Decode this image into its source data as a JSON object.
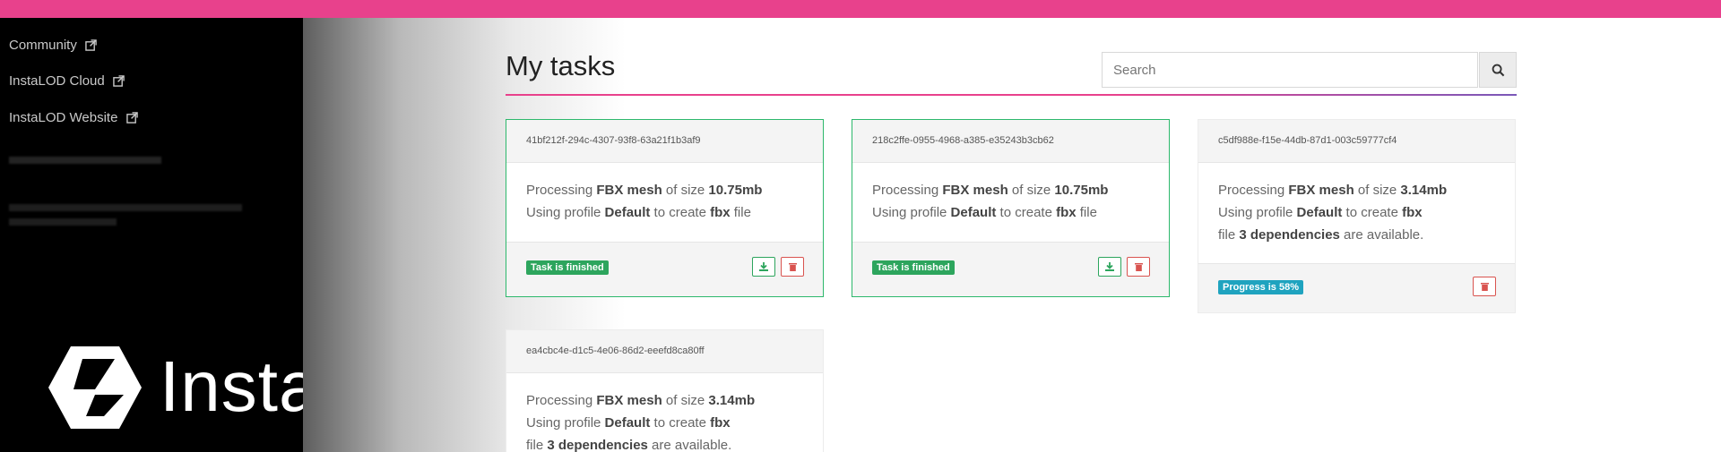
{
  "sidebar": {
    "links": [
      {
        "label": "Community"
      },
      {
        "label": "InstaLOD Cloud"
      },
      {
        "label": "InstaLOD Website"
      }
    ],
    "brand": "InstaLOD"
  },
  "main": {
    "title": "My tasks",
    "search": {
      "placeholder": "Search"
    }
  },
  "tasks": [
    {
      "id": "41bf212f-294c-4307-93f8-63a21f1b3af9",
      "line1_prefix": "Processing ",
      "format": "FBX mesh",
      "line1_mid": " of size ",
      "size": "10.75mb",
      "line2_prefix": "Using profile ",
      "profile": "Default",
      "line2_mid": " to create ",
      "ext": "fbx",
      "line2_suffix": " file",
      "status": "Task is finished"
    },
    {
      "id": "218c2ffe-0955-4968-a385-e35243b3cb62",
      "line1_prefix": "Processing ",
      "format": "FBX mesh",
      "line1_mid": " of size ",
      "size": "10.75mb",
      "line2_prefix": "Using profile ",
      "profile": "Default",
      "line2_mid": " to create ",
      "ext": "fbx",
      "line2_suffix": " file",
      "status": "Task is finished"
    },
    {
      "id": "c5df988e-f15e-44db-87d1-003c59777cf4",
      "line1_prefix": "Processing ",
      "format": "FBX mesh",
      "line1_mid": " of size ",
      "size": "3.14mb",
      "line2_prefix": "Using profile ",
      "profile": "Default",
      "line2_mid": " to create ",
      "ext": "fbx",
      "line3_prefix": "file ",
      "deps": "3 dependencies",
      "line3_suffix": " are available.",
      "status": "Progress is 58%"
    },
    {
      "id": "ea4cbc4e-d1c5-4e06-86d2-eeefd8ca80ff",
      "line1_prefix": "Processing ",
      "format": "FBX mesh",
      "line1_mid": " of size ",
      "size": "3.14mb",
      "line2_prefix": "Using profile ",
      "profile": "Default",
      "line2_mid": " to create ",
      "ext": "fbx",
      "line3_prefix": "file ",
      "deps": "3 dependencies",
      "line3_suffix": " are available."
    }
  ],
  "colors": {
    "accent": "#e8418c",
    "success": "#2da55d",
    "info": "#1fa3bf",
    "danger": "#d9534f"
  },
  "icons": [
    "external-link-icon",
    "search-icon",
    "download-icon",
    "trash-icon",
    "instalod-logo-icon"
  ]
}
